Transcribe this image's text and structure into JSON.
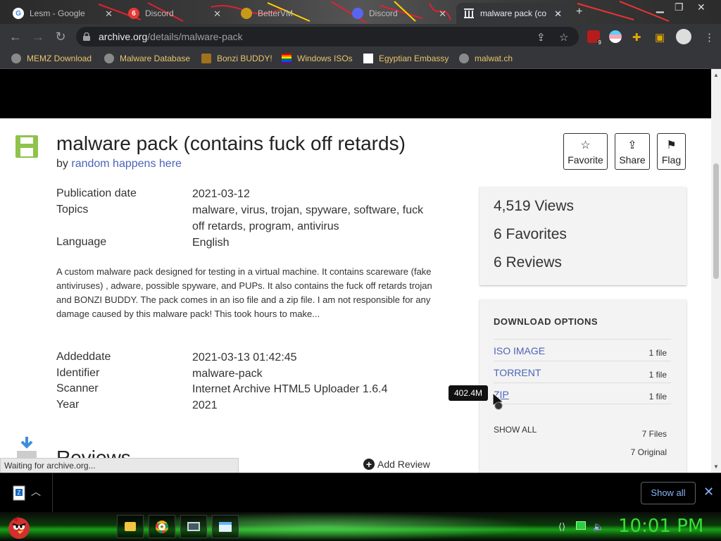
{
  "tabs": [
    {
      "label": "Lesm - Google",
      "favicon": "G",
      "favicon_color": "#4285f4"
    },
    {
      "label": "Discord",
      "favicon": "6",
      "favicon_color": "#e53935"
    },
    {
      "label": "BetterVM",
      "favicon": "",
      "favicon_color": "#c99a1a"
    },
    {
      "label": "Discord",
      "favicon": "",
      "favicon_color": "#5865f2"
    },
    {
      "label": "malware pack (co",
      "favicon": "",
      "favicon_color": "#ffffff"
    }
  ],
  "toolbar": {
    "url_host": "archive.org",
    "url_path": "/details/malware-pack",
    "ext_badge": "9"
  },
  "bookmarks": [
    {
      "label": "MEMZ Download"
    },
    {
      "label": "Malware Database"
    },
    {
      "label": "Bonzi BUDDY!"
    },
    {
      "label": "Windows ISOs"
    },
    {
      "label": "Egyptian Embassy"
    },
    {
      "label": "malwat.ch"
    }
  ],
  "item": {
    "title": "malware pack (contains fuck off retards)",
    "by_prefix": "by",
    "author": "random happens here"
  },
  "actions": {
    "favorite": "Favorite",
    "share": "Share",
    "flag": "Flag"
  },
  "metadata": {
    "pub_label": "Publication date",
    "pub_value": "2021-03-12",
    "topics_label": "Topics",
    "topics_line1": "malware, virus, trojan, spyware, software, fuck",
    "topics_line2": "off retards, program, antivirus",
    "lang_label": "Language",
    "lang_value": "English"
  },
  "description": "A custom malware pack designed for testing in a virtual machine. It contains scareware (fake antiviruses) , adware, possible spyware, and PUPs. It also contains the fuck off retards trojan and BONZI BUDDY. The pack comes in an iso file and a zip file. I am not responsible for any damage caused by this malware pack! This took hours to make...",
  "details": {
    "added_label": "Addeddate",
    "added_value": "2021-03-13 01:42:45",
    "id_label": "Identifier",
    "id_value": "malware-pack",
    "scanner_label": "Scanner",
    "scanner_value": "Internet Archive HTML5 Uploader 1.6.4",
    "year_label": "Year",
    "year_value": "2021"
  },
  "stats": {
    "views": "4,519 Views",
    "favorites": "6 Favorites",
    "reviews": "6 Reviews"
  },
  "downloads": {
    "heading": "DOWNLOAD OPTIONS",
    "rows": [
      {
        "name": "ISO IMAGE",
        "count": "1 file"
      },
      {
        "name": "TORRENT",
        "count": "1 file"
      },
      {
        "name": "ZIP",
        "count": "1 file"
      }
    ],
    "show_all": "SHOW ALL",
    "files": "7 Files",
    "original": "7 Original",
    "tooltip": "402.4M"
  },
  "reviews": {
    "heading": "Reviews",
    "add": "Add Review"
  },
  "status_text": "Waiting for archive.org...",
  "download_bar": {
    "show_all": "Show all"
  },
  "clock": "10:01 PM",
  "colors": {
    "link": "#4b64b8",
    "clock": "#35e035",
    "bookmark_text": "#e9c46a"
  }
}
